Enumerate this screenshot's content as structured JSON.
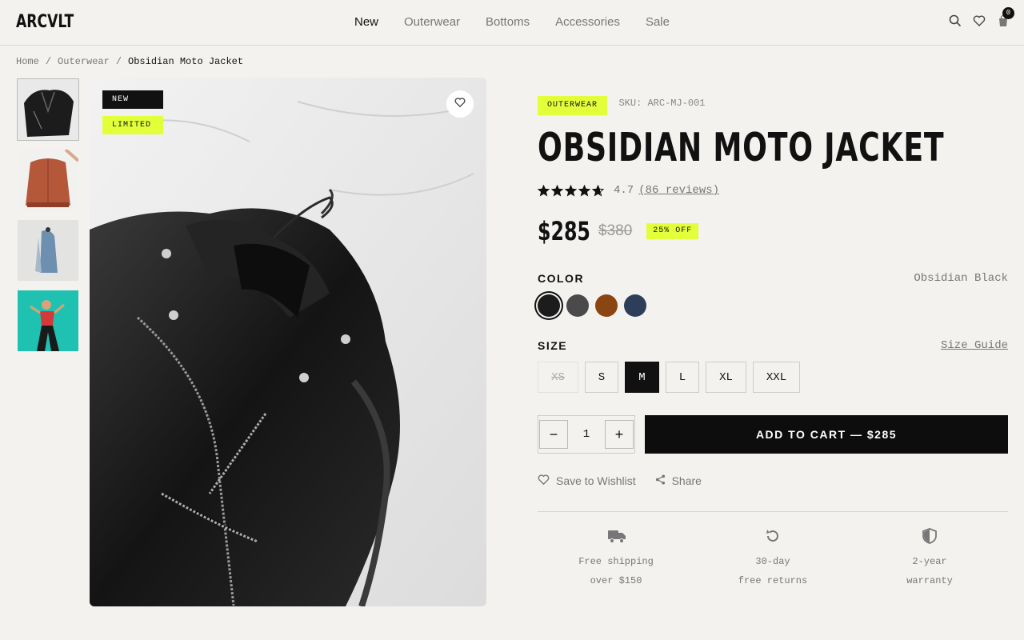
{
  "brand": {
    "logo": "ARCVLT"
  },
  "nav": {
    "items": [
      "New",
      "Outerwear",
      "Bottoms",
      "Accessories",
      "Sale"
    ],
    "active": "New"
  },
  "header": {
    "cart_count": "0",
    "icons": [
      "search-icon",
      "heart-icon",
      "bag-icon"
    ]
  },
  "breadcrumb": {
    "items": [
      "Home",
      "Outerwear",
      "Obsidian Moto Jacket"
    ]
  },
  "gallery": {
    "thumbnails": [
      "black leather jacket",
      "rust bomber jacket",
      "denim jacket on hook",
      "model on teal background"
    ],
    "tags": {
      "new": "NEW",
      "limited": "LIMITED"
    }
  },
  "product": {
    "category": "OUTERWEAR",
    "sku": "SKU: ARC-MJ-001",
    "title": "OBSIDIAN MOTO JACKET",
    "rating": "4.7",
    "rating_value": 4.7,
    "reviews": "(86 reviews)",
    "price": "$285",
    "old_price": "$380",
    "discount": "25% OFF"
  },
  "color": {
    "label": "COLOR",
    "selected_name": "Obsidian Black",
    "swatches": [
      "#1c1c1c",
      "#4a4a4a",
      "#8b4513",
      "#2c3e5a"
    ],
    "selected_index": 0
  },
  "size": {
    "label": "SIZE",
    "guide": "Size Guide",
    "options": [
      "XS",
      "S",
      "M",
      "L",
      "XL",
      "XXL"
    ],
    "selected": "M",
    "unavailable": [
      "XS"
    ]
  },
  "cart": {
    "qty_minus": "−",
    "qty_plus": "+",
    "quantity": "1",
    "add_label": "ADD TO CART — $285"
  },
  "actions": {
    "wishlist": "Save to Wishlist",
    "share": "Share"
  },
  "perks": [
    {
      "icon": "truck-icon",
      "line1": "Free shipping",
      "line2": "over $150"
    },
    {
      "icon": "return-icon",
      "line1": "30-day",
      "line2": "free returns"
    },
    {
      "icon": "shield-icon",
      "line1": "2-year",
      "line2": "warranty"
    }
  ],
  "colors": {
    "accent": "#e2ff3a",
    "ink": "#111111",
    "background": "#f3f2ee"
  }
}
